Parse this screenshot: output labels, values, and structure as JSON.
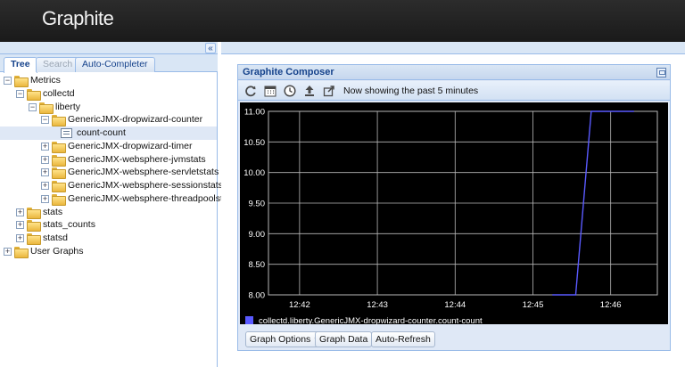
{
  "app": {
    "title": "Graphite"
  },
  "left_panel": {
    "collapse_label": "«",
    "tabs": [
      {
        "label": "Tree",
        "state": "active"
      },
      {
        "label": "Search",
        "state": "disabled"
      },
      {
        "label": "Auto-Completer",
        "state": "normal"
      }
    ]
  },
  "tree": [
    {
      "label": "Metrics",
      "level": 0,
      "kind": "folder",
      "expanded": true
    },
    {
      "label": "collectd",
      "level": 1,
      "kind": "folder",
      "expanded": true
    },
    {
      "label": "liberty",
      "level": 2,
      "kind": "folder",
      "expanded": true
    },
    {
      "label": "GenericJMX-dropwizard-counter",
      "level": 3,
      "kind": "folder",
      "expanded": true
    },
    {
      "label": "count-count",
      "level": 4,
      "kind": "leaf",
      "selected": true
    },
    {
      "label": "GenericJMX-dropwizard-timer",
      "level": 3,
      "kind": "folder",
      "expanded": false
    },
    {
      "label": "GenericJMX-websphere-jvmstats",
      "level": 3,
      "kind": "folder",
      "expanded": false
    },
    {
      "label": "GenericJMX-websphere-servletstats",
      "level": 3,
      "kind": "folder",
      "expanded": false
    },
    {
      "label": "GenericJMX-websphere-sessionstats",
      "level": 3,
      "kind": "folder",
      "expanded": false
    },
    {
      "label": "GenericJMX-websphere-threadpoolstats",
      "level": 3,
      "kind": "folder",
      "expanded": false
    },
    {
      "label": "stats",
      "level": 1,
      "kind": "folder",
      "expanded": false
    },
    {
      "label": "stats_counts",
      "level": 1,
      "kind": "folder",
      "expanded": false
    },
    {
      "label": "statsd",
      "level": 1,
      "kind": "folder",
      "expanded": false
    },
    {
      "label": "User Graphs",
      "level": 0,
      "kind": "folder",
      "expanded": false
    }
  ],
  "composer": {
    "title": "Graphite Composer",
    "toolbar": {
      "icons": [
        "refresh-icon",
        "calendar-icon",
        "clock-icon",
        "upload-icon",
        "share-icon"
      ],
      "status_text": "Now showing the past 5 minutes"
    },
    "buttons": {
      "graph_options": "Graph Options",
      "graph_data": "Graph Data",
      "auto_refresh": "Auto-Refresh"
    }
  },
  "colors": {
    "series": "#5a5aff",
    "graph_bg": "#000000",
    "grid": "#b8b8b8",
    "axis_text": "#ffffff"
  },
  "chart_data": {
    "type": "line",
    "title": "",
    "xlabel": "",
    "ylabel": "",
    "x_ticks": [
      "12:42",
      "12:43",
      "12:44",
      "12:45",
      "12:46"
    ],
    "x_tick_minutes": [
      42,
      43,
      44,
      45,
      46
    ],
    "xlim_minutes": [
      41.6,
      46.6
    ],
    "y_ticks": [
      "8.00",
      "8.50",
      "9.00",
      "9.50",
      "10.00",
      "10.50",
      "11.00"
    ],
    "ylim": [
      8.0,
      11.0
    ],
    "grid": true,
    "legend_position": "bottom-left",
    "series": [
      {
        "name": "collectd.liberty.GenericJMX-dropwizard-counter.count-count",
        "x_minutes": [
          45.25,
          45.55,
          45.75,
          46.3
        ],
        "y": [
          8.0,
          8.0,
          11.0,
          11.0
        ]
      }
    ]
  }
}
